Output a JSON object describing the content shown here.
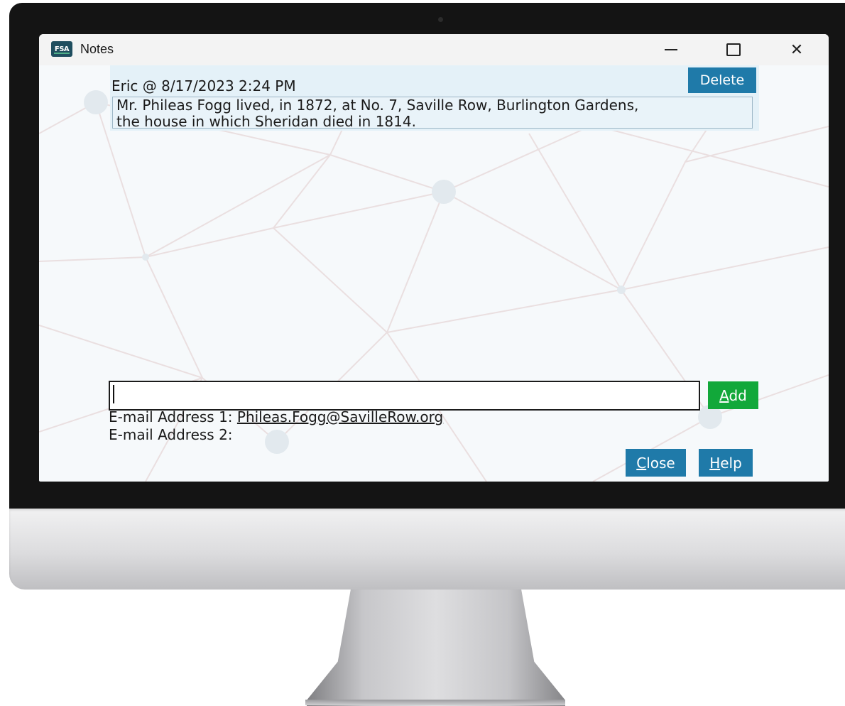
{
  "window": {
    "title": "Notes",
    "app_icon_text": "FSA"
  },
  "note": {
    "header": "Eric @ 8/17/2023 2:24 PM",
    "text": "Mr. Phileas Fogg lived, in 1872, at No. 7, Saville Row, Burlington Gardens,\nthe house in which Sheridan died in 1814.",
    "delete_label": "Delete"
  },
  "input": {
    "value": "",
    "add_label_mnemonic": "A",
    "add_label_rest": "dd"
  },
  "emails": {
    "label1": "E-mail Address 1: ",
    "value1": "Phileas.Fogg@SavilleRow.org",
    "label2": "E-mail Address 2:",
    "value2": ""
  },
  "buttons": {
    "close_mnemonic": "C",
    "close_rest": "lose",
    "help_mnemonic": "H",
    "help_rest": "elp"
  },
  "colors": {
    "accent_blue": "#1f7aa9",
    "add_green": "#12a83a",
    "note_bg": "#e4f1f8"
  }
}
